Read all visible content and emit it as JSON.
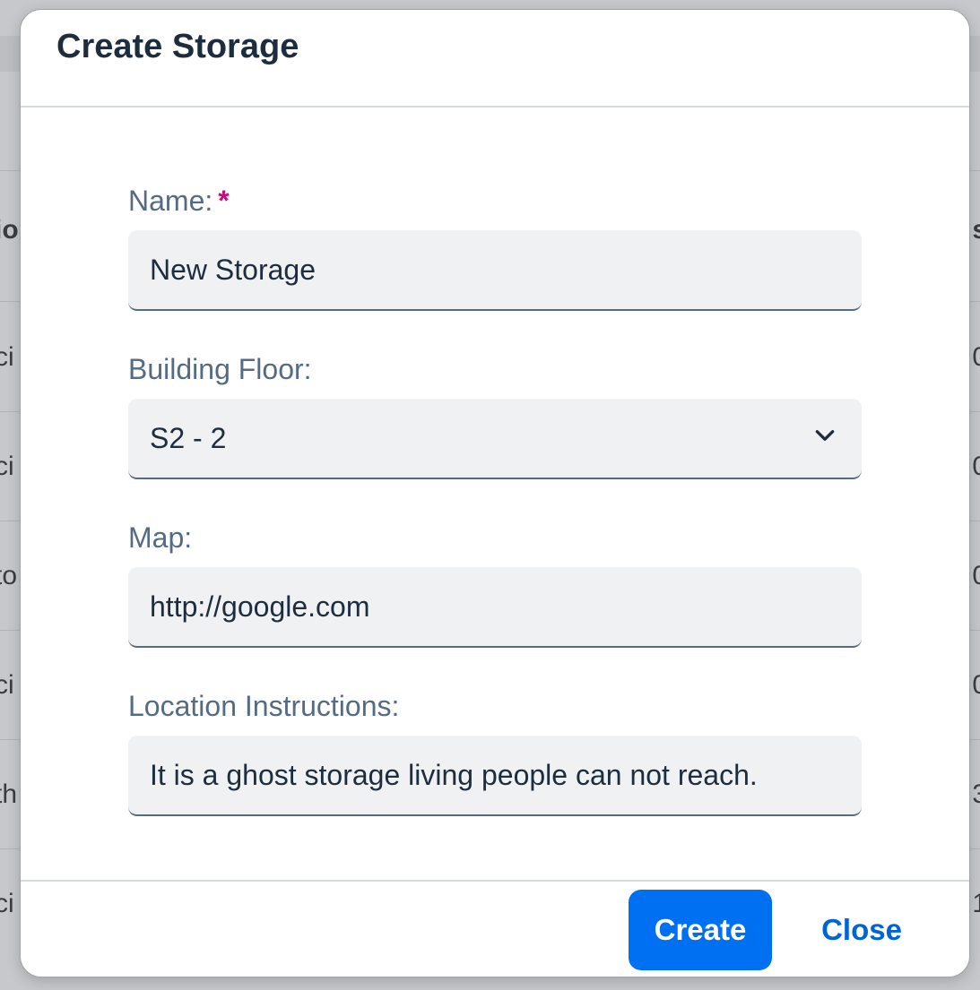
{
  "background": {
    "left_fragments": [
      "io",
      "ci",
      "ci",
      "to",
      "ci",
      "th",
      "ci"
    ],
    "right_fragments": [
      "s",
      "0",
      "0",
      "0",
      "0",
      "3",
      "1"
    ]
  },
  "dialog": {
    "title": "Create Storage",
    "fields": {
      "name": {
        "label": "Name:",
        "required_mark": "*",
        "value": "New Storage"
      },
      "building_floor": {
        "label": "Building Floor:",
        "value": "S2 - 2"
      },
      "map": {
        "label": "Map:",
        "value": "http://google.com"
      },
      "location_instructions": {
        "label": "Location Instructions:",
        "value": "It is a ghost storage living people can not reach."
      }
    },
    "footer": {
      "create_label": "Create",
      "close_label": "Close"
    }
  },
  "colors": {
    "primary_button": "#0070f2",
    "link_button": "#0064d9",
    "required": "#c0117a"
  }
}
